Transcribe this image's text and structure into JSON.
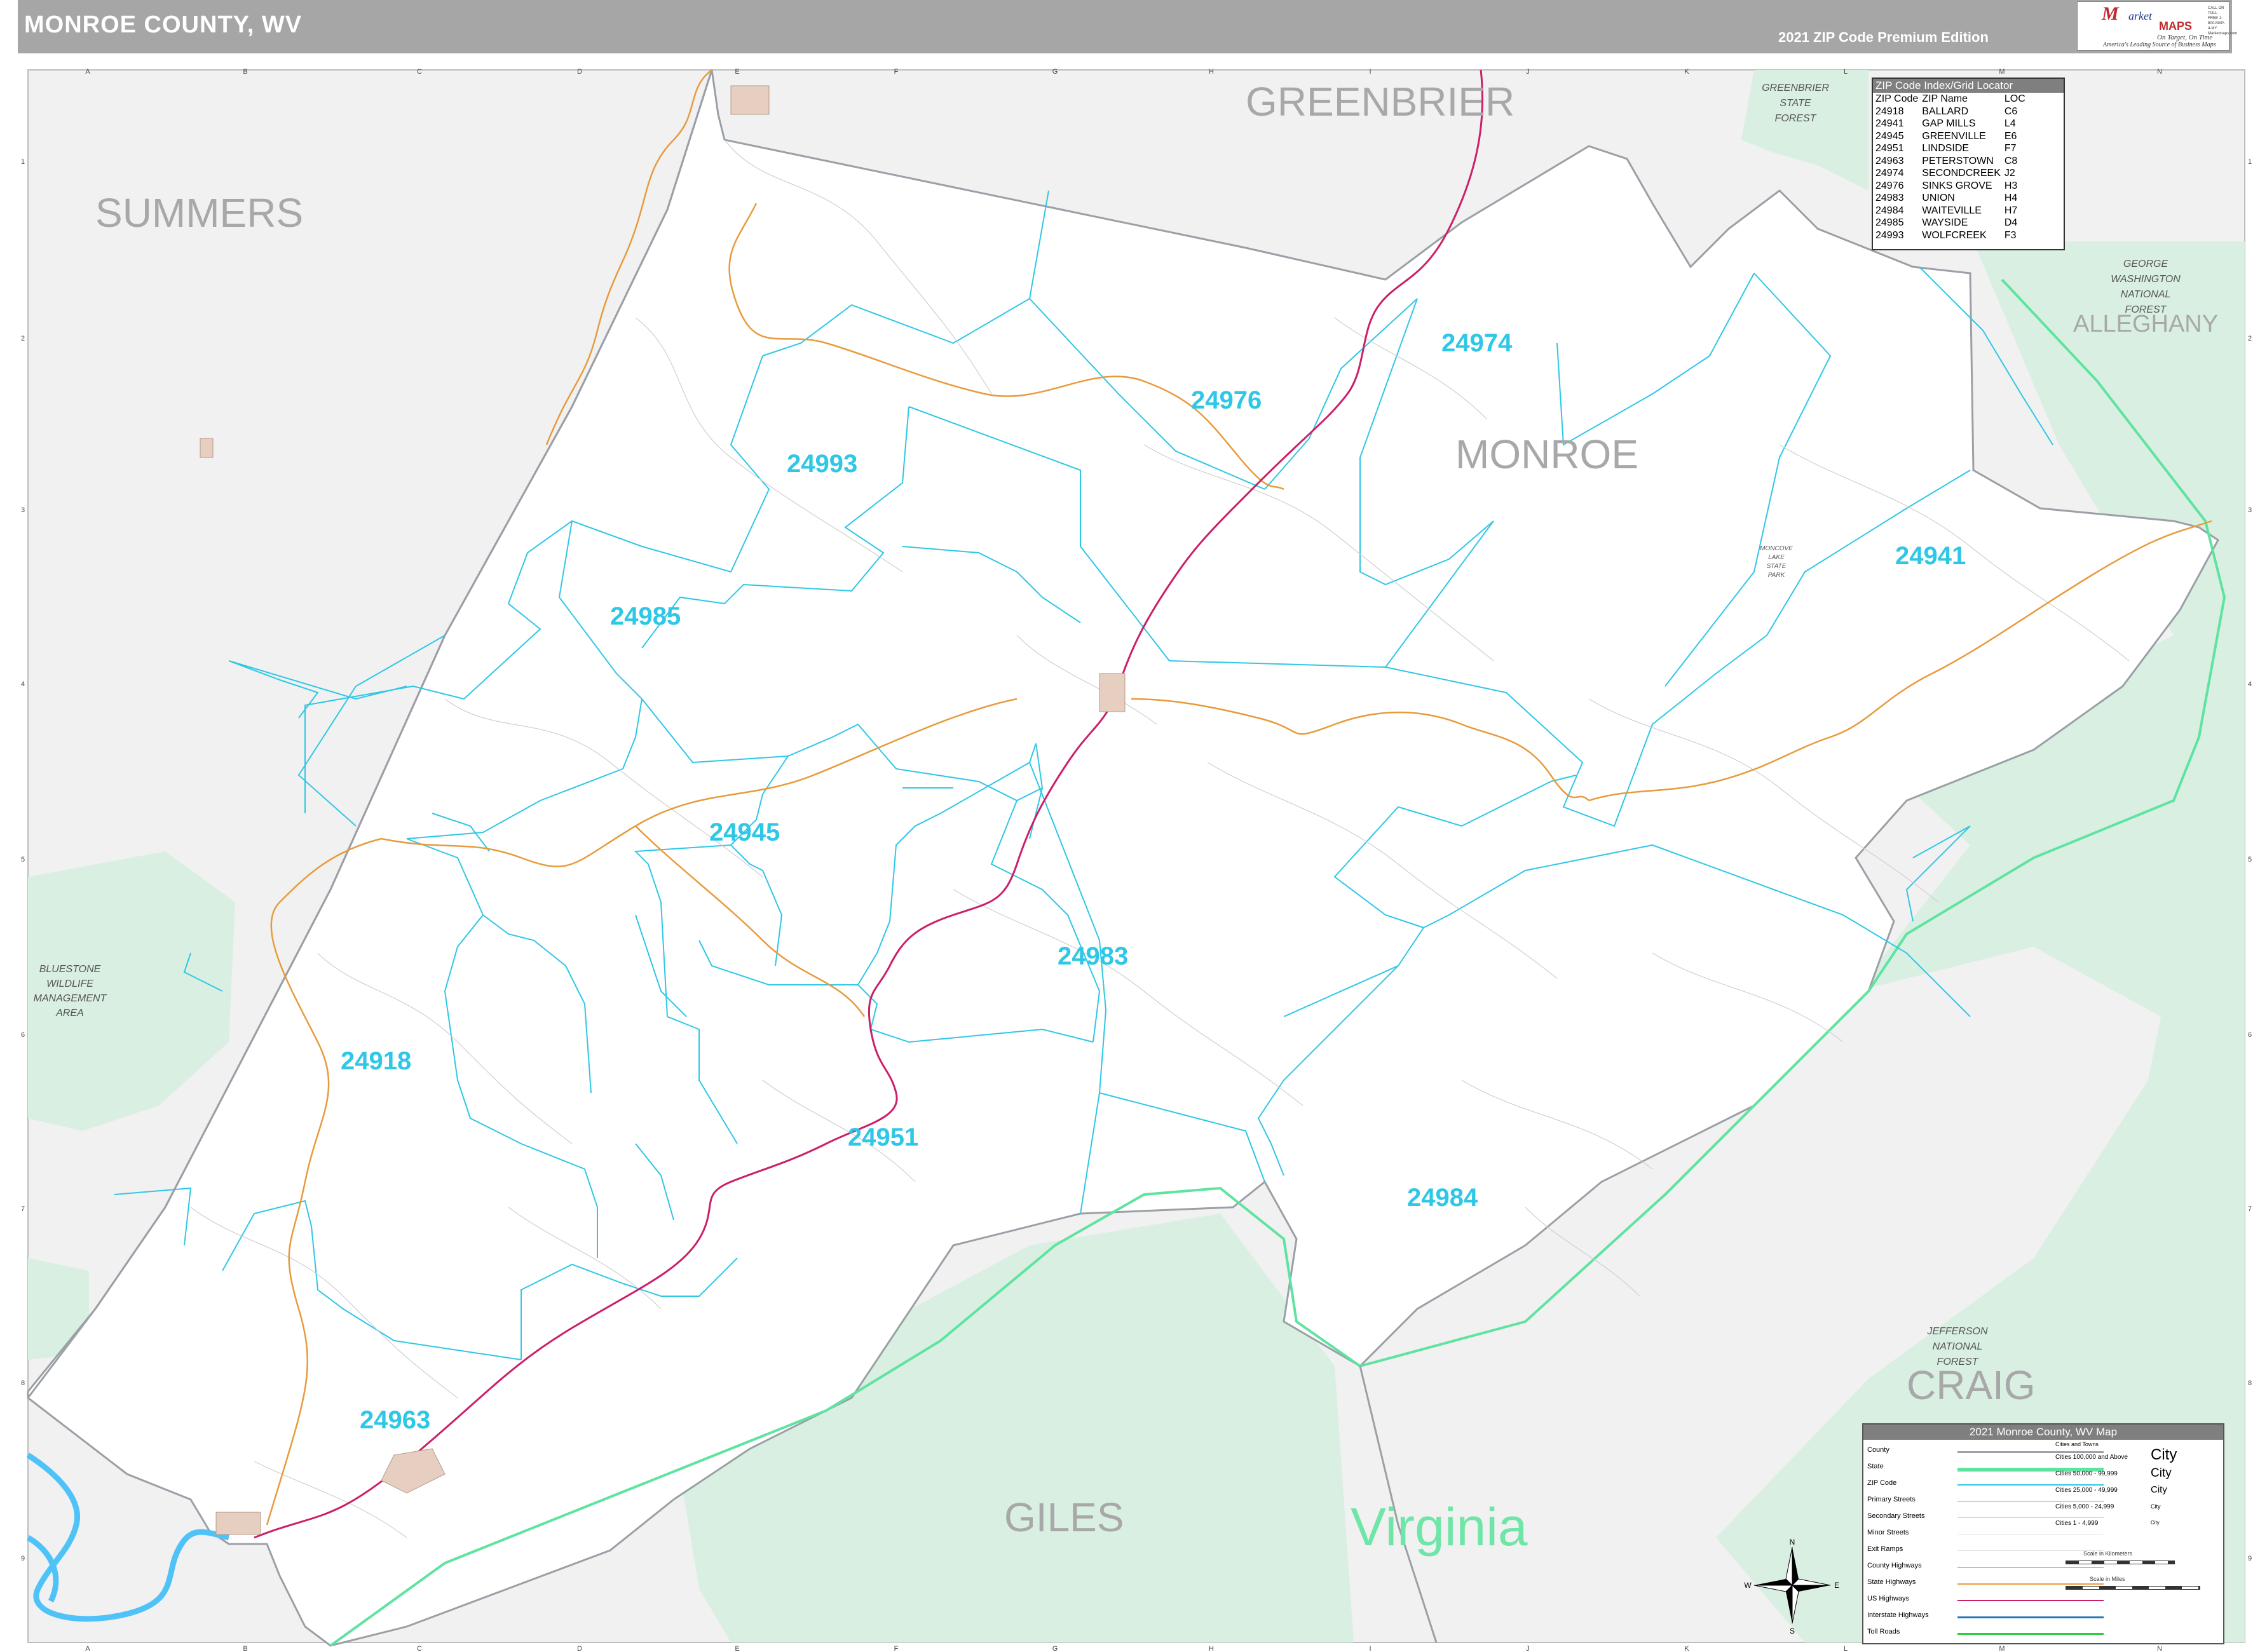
{
  "header": {
    "title": "MONROE COUNTY, WV",
    "edition": "2021 ZIP Code Premium Edition"
  },
  "logo": {
    "line1": "M",
    "line2": "arket",
    "line3": "MAPS",
    "line4": "On Target, On Time",
    "line5": "America's Leading Source of Business Maps",
    "contact": "CALL OR TOLL FREE 1-800-MAP-4-MY Marketmaps.com"
  },
  "grid": {
    "columns": [
      "A",
      "B",
      "C",
      "D",
      "E",
      "F",
      "G",
      "H",
      "I",
      "J",
      "K",
      "L",
      "M",
      "N"
    ],
    "rows": [
      "1",
      "2",
      "3",
      "4",
      "5",
      "6",
      "7",
      "8",
      "9"
    ]
  },
  "regions": {
    "greenbrier": "GREENBRIER",
    "summers": "SUMMERS",
    "monroe": "MONROE",
    "alleghany": "ALLEGHANY",
    "craig": "CRAIG",
    "giles": "GILES",
    "virginia": "Virginia"
  },
  "parks": {
    "greenbrier_forest": [
      "GREENBRIER",
      "STATE",
      "FOREST"
    ],
    "gw_forest": [
      "GEORGE",
      "WASHINGTON",
      "NATIONAL",
      "FOREST"
    ],
    "bluestone": [
      "BLUESTONE",
      "WILDLIFE",
      "MANAGEMENT",
      "AREA"
    ],
    "jefferson": [
      "JEFFERSON",
      "NATIONAL",
      "FOREST"
    ],
    "moncove": [
      "MONCOVE",
      "LAKE",
      "STATE",
      "PARK"
    ]
  },
  "zip_labels": {
    "z24974": "24974",
    "z24976": "24976",
    "z24993": "24993",
    "z24985": "24985",
    "z24941": "24941",
    "z24945": "24945",
    "z24983": "24983",
    "z24918": "24918",
    "z24951": "24951",
    "z24984": "24984",
    "z24963": "24963"
  },
  "zip_index": {
    "title": "ZIP Code Index/Grid Locator",
    "headers": [
      "ZIP Code",
      "ZIP Name",
      "LOC"
    ],
    "rows": [
      [
        "24918",
        "BALLARD",
        "C6"
      ],
      [
        "24941",
        "GAP MILLS",
        "L4"
      ],
      [
        "24945",
        "GREENVILLE",
        "E6"
      ],
      [
        "24951",
        "LINDSIDE",
        "F7"
      ],
      [
        "24963",
        "PETERSTOWN",
        "C8"
      ],
      [
        "24974",
        "SECONDCREEK",
        "J2"
      ],
      [
        "24976",
        "SINKS GROVE",
        "H3"
      ],
      [
        "24983",
        "UNION",
        "H4"
      ],
      [
        "24984",
        "WAITEVILLE",
        "H7"
      ],
      [
        "24985",
        "WAYSIDE",
        "D4"
      ],
      [
        "24993",
        "WOLFCREEK",
        "F3"
      ]
    ]
  },
  "legend": {
    "title": "2021 Monroe County, WV Map",
    "items": [
      "County",
      "State",
      "ZIP Code",
      "Primary Streets",
      "Secondary Streets",
      "Minor Streets",
      "Exit Ramps",
      "County Highways",
      "State Highways",
      "US Highways",
      "Interstate Highways",
      "Toll Roads"
    ],
    "cities_title": "Cities and Towns",
    "cities": [
      "Cities 100,000 and Above",
      "Cities 50,000 - 99,999",
      "Cities 25,000 - 49,999",
      "Cities 5,000 - 24,999",
      "Cities 1 - 4,999"
    ],
    "city_samples": [
      "City",
      "City",
      "City",
      "City",
      "City"
    ],
    "scale_km": "Scale in Kilometers",
    "scale_mi": "Scale in Miles"
  },
  "compass": {
    "n": "N",
    "s": "S",
    "e": "E",
    "w": "W"
  },
  "colors": {
    "zip": "#2fc7e6",
    "county": "#9aa0a6",
    "state": "#5fe3a1",
    "us_highway": "#cc1f6a",
    "state_highway": "#e89a3c",
    "forest": "#d9efe2",
    "water": "#4fc3f7"
  }
}
